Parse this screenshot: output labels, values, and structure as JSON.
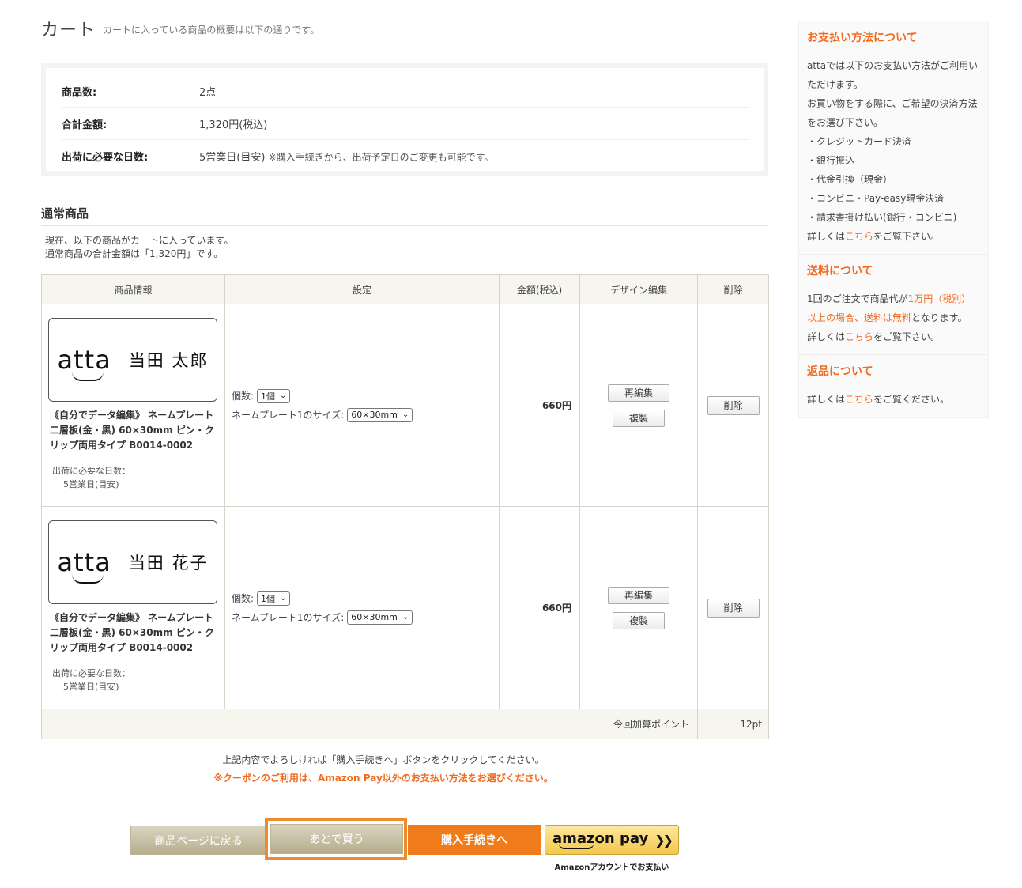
{
  "header": {
    "title": "カート",
    "subtitle": "カートに入っている商品の概要は以下の通りです。"
  },
  "summary": {
    "count_label": "商品数:",
    "count_value": "2点",
    "total_label": "合計金額:",
    "total_value": "1,320円(税込)",
    "days_label": "出荷に必要な日数:",
    "days_value": "5営業日(目安)",
    "days_note": "※購入手続きから、出荷予定日のご変更も可能です。"
  },
  "section": {
    "title": "通常商品",
    "intro1": "現在、以下の商品がカートに入っています。",
    "intro2": "通常商品の合計金額は「1,320円」です。"
  },
  "table": {
    "headers": [
      "商品情報",
      "設定",
      "金額(税込)",
      "デザイン編集",
      "削除"
    ],
    "rows": [
      {
        "brand": "atta",
        "plate_name": "当田 太郎",
        "title": "《自分でデータ編集》 ネームプレート 二層板(金・黒) 60×30mm ピン・クリップ両用タイプ B0014-0002",
        "ship_label": "出荷に必要な日数：",
        "ship_days": "5営業日(目安)",
        "qty_label": "個数:",
        "qty_value": "1個",
        "size_label": "ネームプレート1のサイズ:",
        "size_value": "60×30mm",
        "price": "660円",
        "reedit": "再編集",
        "copy": "複製",
        "delete": "削除"
      },
      {
        "brand": "atta",
        "plate_name": "当田 花子",
        "title": "《自分でデータ編集》 ネームプレート 二層板(金・黒) 60×30mm ピン・クリップ両用タイプ B0014-0002",
        "ship_label": "出荷に必要な日数：",
        "ship_days": "5営業日(目安)",
        "qty_label": "個数:",
        "qty_value": "1個",
        "size_label": "ネームプレート1のサイズ:",
        "size_value": "60×30mm",
        "price": "660円",
        "reedit": "再編集",
        "copy": "複製",
        "delete": "削除"
      }
    ],
    "points_label": "今回加算ポイント",
    "points_value": "12pt"
  },
  "notes": {
    "line1": "上記内容でよろしければ「購入手続きへ」ボタンをクリックしてください。",
    "line2": "※クーポンのご利用は、Amazon Pay以外のお支払い方法をお選びください。"
  },
  "buttons": {
    "back": "商品ページに戻る",
    "later": "あとで買う",
    "checkout": "購入手続きへ",
    "amazon_pay": "amazon pay",
    "amazon_arrows": "❯❯",
    "amazon_sub": "Amazonアカウントでお支払い"
  },
  "sidebar": {
    "payment": {
      "title": "お支払い方法について",
      "line1": "attaでは以下のお支払い方法がご利用いただけます。",
      "line2": "お買い物をする際に、ご希望の決済方法をお選び下さい。",
      "methods": [
        "・クレジットカード決済",
        "・銀行振込",
        "・代金引換（現金）",
        "・コンビニ・Pay-easy現金決済",
        "・請求書掛け払い(銀行・コンビニ)"
      ],
      "more_prefix": "詳しくは",
      "more_link": "こちら",
      "more_suffix": "をご覧下さい。"
    },
    "shipping": {
      "title": "送料について",
      "text1": "1回のご注文で商品代が",
      "text_hl1": "1万円（税別）以上の場合、送料は無料",
      "text2": "となります。",
      "more_prefix": "詳しくは",
      "more_link": "こちら",
      "more_suffix": "をご覧下さい。"
    },
    "returns": {
      "title": "返品について",
      "more_prefix": "詳しくは",
      "more_link": "こちら",
      "more_suffix": "をご覧ください。"
    }
  },
  "colors": {
    "accent": "#f26b1d",
    "table_header": "#f6f5ee",
    "beige_button": "#c8c0a2"
  }
}
